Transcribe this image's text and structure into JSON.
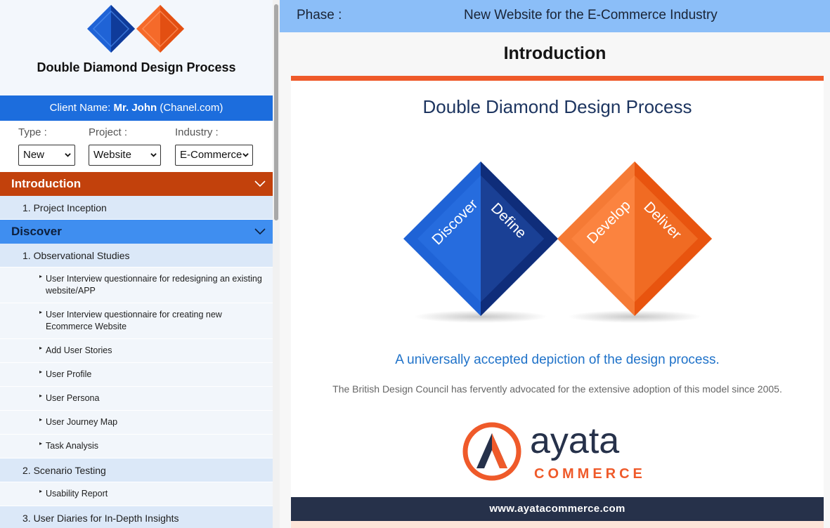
{
  "sidebar": {
    "brand_title": "Double Diamond Design Process",
    "client": {
      "prefix": "Client Name: ",
      "name": "Mr. John",
      "site": " (Chanel.com)"
    },
    "filters": {
      "type": {
        "label": "Type :",
        "value": "New"
      },
      "project": {
        "label": "Project :",
        "value": "Website"
      },
      "industry": {
        "label": "Industry :",
        "value": "E-Commerce"
      }
    },
    "sections": [
      {
        "title": "Introduction",
        "items": [
          "1. Project Inception"
        ]
      },
      {
        "title": "Discover",
        "items": [
          "1. Observational Studies",
          "2. Scenario Testing",
          "3. User Diaries for In-Depth Insights"
        ],
        "observational_subitems": [
          "User Interview questionnaire for redesigning an existing website/APP",
          "User Interview questionnaire for creating new Ecommerce Website",
          "Add User Stories",
          "User Profile",
          "User Persona",
          "User Journey Map",
          "Task Analysis"
        ],
        "scenario_subitems": [
          "Usability Report"
        ]
      }
    ],
    "bullet": "▸"
  },
  "main": {
    "phase_label": "Phase :",
    "phase_value": "New Website for the E-Commerce Industry",
    "page_title": "Introduction",
    "slide": {
      "title": "Double Diamond Design Process",
      "diamond_labels": [
        "Discover",
        "Define",
        "Develop",
        "Deliver"
      ],
      "tagline": "A universally accepted depiction of the design process.",
      "advocacy": "The British Design Council has fervently advocated for the extensive adoption of this model since 2005.",
      "logo_word": "ayata",
      "logo_sub": "COMMERCE",
      "footer_url": "www.ayatacommerce.com"
    }
  },
  "colors": {
    "sidebar_blue": "#1c6ddd",
    "intro_orange": "#c2410c",
    "discover_blue": "#3f8ef0",
    "phase_bar": "#8bbef8",
    "accent_orange": "#ef5a2a",
    "diamond_blue": "#1f63d6",
    "diamond_navy": "#0f2d7a",
    "diamond_orange": "#f2621f",
    "footer_navy": "#26314a"
  }
}
